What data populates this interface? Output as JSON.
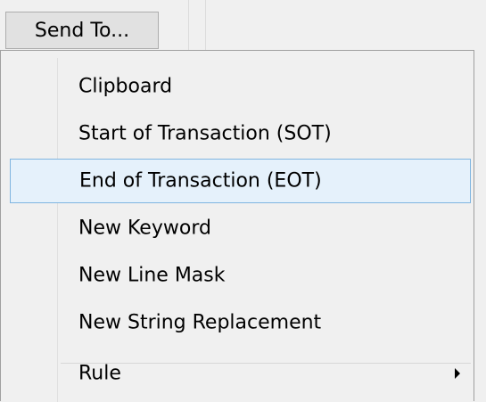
{
  "toolbar": {
    "send_to_label": "Send To..."
  },
  "menu": {
    "items": [
      {
        "label": "Clipboard",
        "highlighted": false
      },
      {
        "label": "Start of Transaction (SOT)",
        "highlighted": false
      },
      {
        "label": "End of Transaction (EOT)",
        "highlighted": true
      },
      {
        "label": "New Keyword",
        "highlighted": false
      },
      {
        "label": "New Line Mask",
        "highlighted": false
      },
      {
        "label": "New String Replacement",
        "highlighted": false
      },
      {
        "label": "Rule",
        "highlighted": false,
        "has_submenu": true
      }
    ]
  },
  "colors": {
    "highlight_bg": "#e5f1fb",
    "highlight_border": "#7fb5e0",
    "menu_bg": "#f0f0f0"
  }
}
